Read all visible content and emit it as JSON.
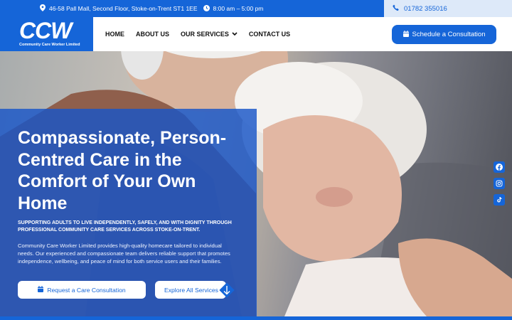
{
  "topbar": {
    "address": "46-58 Pall Mall, Second Floor, Stoke-on-Trent ST1 1EE",
    "hours": "8:00 am – 5:00 pm",
    "phone": "01782 355016"
  },
  "brand": {
    "logo_text": "CCW",
    "company_name": "Community Care Worker Limited"
  },
  "nav": {
    "items": [
      "HOME",
      "ABOUT US",
      "OUR SERVICES",
      "CONTACT US"
    ],
    "cta_label": "Schedule a Consultation"
  },
  "hero": {
    "title": "Compassionate, Person-Centred Care in the Comfort of Your Own Home",
    "kicker": "Supporting adults to live independently, safely, and with dignity through professional community care services across Stoke-on-Trent.",
    "text": "Community Care Worker Limited provides high-quality homecare tailored to individual needs. Our experienced and compassionate team delivers reliable support that promotes independence, wellbeing, and peace of mind for both service users and their families.",
    "primary_button": "Request a Care Consultation",
    "secondary_button": "Explore All Services"
  },
  "social": {
    "icons": [
      "facebook-icon",
      "instagram-icon",
      "tiktok-icon"
    ]
  },
  "colors": {
    "brand_blue": "#1565d8",
    "phone_bg": "#dde9f9"
  }
}
